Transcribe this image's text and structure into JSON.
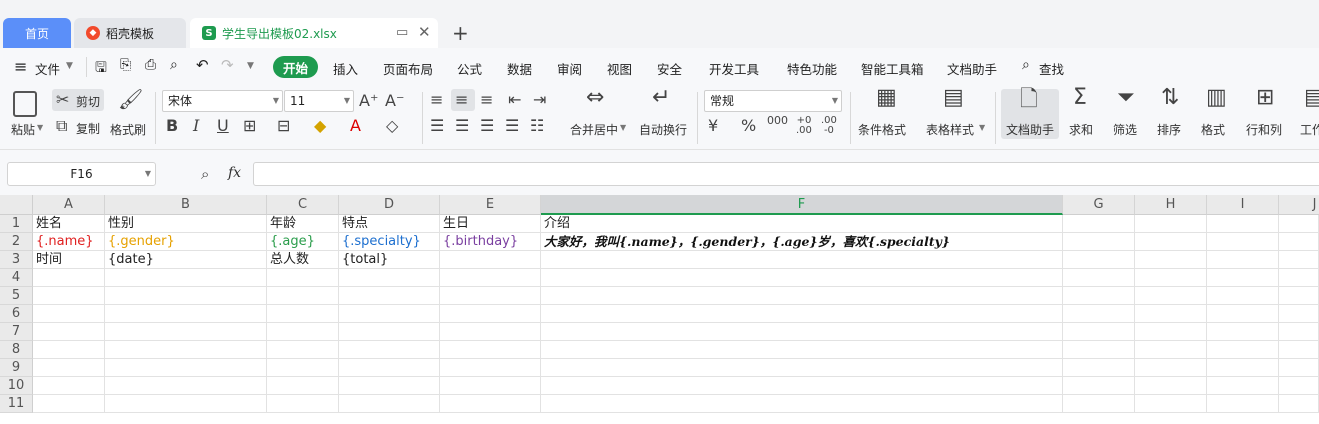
{
  "tabs": {
    "home": "首页",
    "docer": "稻壳模板",
    "file": "学生导出模板02.xlsx"
  },
  "menu": {
    "file": "文件",
    "items": [
      "开始",
      "插入",
      "页面布局",
      "公式",
      "数据",
      "审阅",
      "视图",
      "安全",
      "开发工具",
      "特色功能",
      "智能工具箱",
      "文档助手"
    ],
    "search": "查找"
  },
  "ribbon": {
    "paste": "粘贴",
    "cut": "剪切",
    "copy": "复制",
    "format_painter": "格式刷",
    "font_name": "宋体",
    "font_size": "11",
    "merge_center": "合并居中",
    "wrap_text": "自动换行",
    "number_format": "常规",
    "conditional_format": "条件格式",
    "table_style": "表格样式",
    "doc_assistant": "文档助手",
    "sum": "求和",
    "filter": "筛选",
    "sort": "排序",
    "format": "格式",
    "row_col": "行和列",
    "worksheet": "工作"
  },
  "formula_bar": {
    "cell_ref": "F16",
    "fx": "fx",
    "value": ""
  },
  "grid": {
    "columns": [
      "A",
      "B",
      "C",
      "D",
      "E",
      "F",
      "G",
      "H",
      "I",
      "J"
    ],
    "selected_column": "F",
    "rows": [
      "1",
      "2",
      "3",
      "4",
      "5",
      "6",
      "7",
      "8",
      "9",
      "10",
      "11"
    ],
    "row1": [
      "姓名",
      "性别",
      "年龄",
      "特点",
      "生日",
      "介绍"
    ],
    "row2": [
      "{.name}",
      "{.gender}",
      "{.age}",
      "{.specialty}",
      "{.birthday}",
      "大家好，我叫{.name}，{.gender}，{.age}岁，喜欢{.specialty}"
    ],
    "row3": [
      "时间",
      "{date}",
      "总人数",
      "{total}"
    ]
  },
  "colors": {
    "accent": "#1e9b4f",
    "home_tab": "#5b8ff9",
    "name": "#e02020",
    "gender": "#e6a100",
    "age": "#2a9d4b",
    "specialty": "#1d6fcf",
    "birthday": "#7a3fa0"
  }
}
